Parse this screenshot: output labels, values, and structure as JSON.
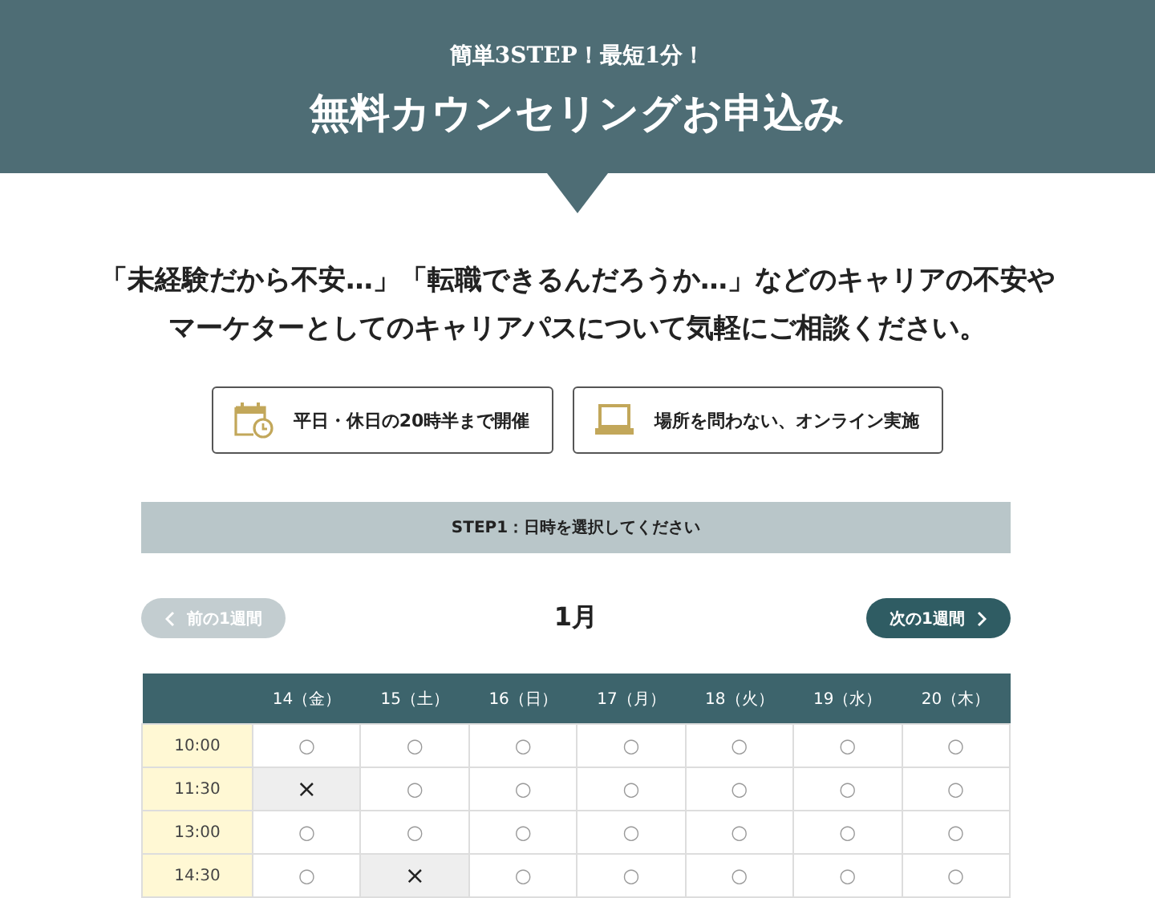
{
  "header": {
    "subtitle": "簡単3STEP！最短1分！",
    "title": "無料カウンセリングお申込み"
  },
  "intro": [
    "「未経験だから不安…」「転職できるんだろうか…」などのキャリアの不安や",
    "マーケターとしてのキャリアパスについて気軽にご相談ください。"
  ],
  "features": [
    {
      "kind": "calendar",
      "label": "平日・休日の20時半まで開催"
    },
    {
      "kind": "laptop",
      "label": "場所を問わない、オンライン実施"
    }
  ],
  "step": "STEP1：日時を選択してください",
  "nav": {
    "prev": {
      "label": "前の1週間",
      "disabled": true
    },
    "month": "1月",
    "next": {
      "label": "次の1週間",
      "disabled": false
    }
  },
  "table": {
    "columns": [
      "14（金）",
      "15（土）",
      "16（日）",
      "17（月）",
      "18（火）",
      "19（水）",
      "20（木）"
    ],
    "rows": [
      {
        "time": "10:00",
        "cells": [
          {
            "mark": "○",
            "available": true
          },
          {
            "mark": "○",
            "available": true
          },
          {
            "mark": "○",
            "available": true
          },
          {
            "mark": "○",
            "available": true
          },
          {
            "mark": "○",
            "available": true
          },
          {
            "mark": "○",
            "available": true
          },
          {
            "mark": "○",
            "available": true
          }
        ]
      },
      {
        "time": "11:30",
        "cells": [
          {
            "mark": "×",
            "available": false
          },
          {
            "mark": "○",
            "available": true
          },
          {
            "mark": "○",
            "available": true
          },
          {
            "mark": "○",
            "available": true
          },
          {
            "mark": "○",
            "available": true
          },
          {
            "mark": "○",
            "available": true
          },
          {
            "mark": "○",
            "available": true
          }
        ]
      },
      {
        "time": "13:00",
        "cells": [
          {
            "mark": "○",
            "available": true
          },
          {
            "mark": "○",
            "available": true
          },
          {
            "mark": "○",
            "available": true
          },
          {
            "mark": "○",
            "available": true
          },
          {
            "mark": "○",
            "available": true
          },
          {
            "mark": "○",
            "available": true
          },
          {
            "mark": "○",
            "available": true
          }
        ]
      },
      {
        "time": "14:30",
        "cells": [
          {
            "mark": "○",
            "available": true
          },
          {
            "mark": "×",
            "available": false
          },
          {
            "mark": "○",
            "available": true
          },
          {
            "mark": "○",
            "available": true
          },
          {
            "mark": "○",
            "available": true
          },
          {
            "mark": "○",
            "available": true
          },
          {
            "mark": "○",
            "available": true
          }
        ]
      }
    ]
  }
}
